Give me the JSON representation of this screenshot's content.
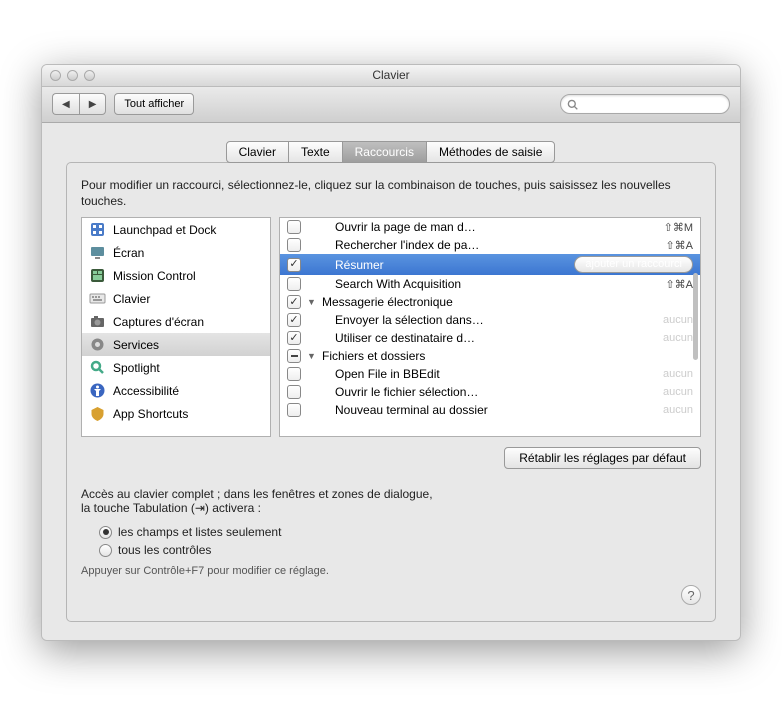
{
  "window": {
    "title": "Clavier"
  },
  "toolbar": {
    "show_all": "Tout afficher",
    "search_placeholder": " "
  },
  "tabs": [
    "Clavier",
    "Texte",
    "Raccourcis",
    "Méthodes de saisie"
  ],
  "active_tab": 2,
  "intro": "Pour modifier un raccourci, sélectionnez-le, cliquez sur la combinaison de touches, puis saisissez les nouvelles touches.",
  "categories": [
    {
      "label": "Launchpad et Dock",
      "icon": "launchpad"
    },
    {
      "label": "Écran",
      "icon": "screen"
    },
    {
      "label": "Mission Control",
      "icon": "mission"
    },
    {
      "label": "Clavier",
      "icon": "keyboard"
    },
    {
      "label": "Captures d'écran",
      "icon": "camera"
    },
    {
      "label": "Services",
      "icon": "gear",
      "selected": true
    },
    {
      "label": "Spotlight",
      "icon": "spotlight"
    },
    {
      "label": "Accessibilité",
      "icon": "access"
    },
    {
      "label": "App Shortcuts",
      "icon": "app"
    }
  ],
  "shortcuts": [
    {
      "checked": false,
      "label": "Ouvrir la page de man d…",
      "shortcut": "⇧⌘M",
      "level": 1
    },
    {
      "checked": false,
      "label": "Rechercher l'index de pa…",
      "shortcut": "⇧⌘A",
      "level": 1
    },
    {
      "checked": true,
      "label": "Résumer",
      "add": "ajouter un raccourci",
      "level": 1,
      "selected": true
    },
    {
      "checked": false,
      "label": "Search With Acquisition",
      "shortcut": "⇧⌘A",
      "level": 1
    },
    {
      "checked": true,
      "label": "Messagerie électronique",
      "level": 0,
      "disclosure": "down"
    },
    {
      "checked": true,
      "label": "Envoyer la sélection dans…",
      "shortcut": "aucun",
      "ghost": true,
      "level": 1
    },
    {
      "checked": true,
      "label": "Utiliser ce destinataire d…",
      "shortcut": "aucun",
      "ghost": true,
      "level": 1
    },
    {
      "checked": "dash",
      "label": "Fichiers et dossiers",
      "level": 0,
      "disclosure": "down"
    },
    {
      "checked": false,
      "label": "Open File in BBEdit",
      "shortcut": "aucun",
      "ghost": true,
      "level": 1
    },
    {
      "checked": false,
      "label": "Ouvrir le fichier sélection…",
      "shortcut": "aucun",
      "ghost": true,
      "level": 1
    },
    {
      "checked": false,
      "label": "Nouveau terminal au dossier",
      "shortcut": "aucun",
      "ghost": true,
      "level": 1
    }
  ],
  "restore": "Rétablir les réglages par défaut",
  "access": {
    "line1": "Accès au clavier complet ; dans les fenêtres et zones de dialogue,",
    "line2": "la touche Tabulation (⇥) activera :",
    "opt1": "les champs et listes seulement",
    "opt2": "tous les contrôles",
    "hint": "Appuyer sur Contrôle+F7 pour modifier ce réglage."
  }
}
